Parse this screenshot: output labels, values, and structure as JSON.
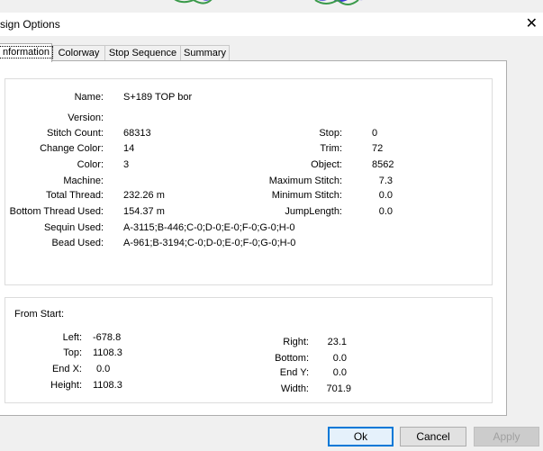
{
  "window": {
    "title": "sign Options",
    "close_glyph": "✕"
  },
  "tabs": [
    {
      "label": "nformation",
      "active": true
    },
    {
      "label": "Colorway",
      "active": false
    },
    {
      "label": "Stop Sequence",
      "active": false
    },
    {
      "label": "Summary",
      "active": false
    }
  ],
  "info": {
    "name_label": "Name:",
    "name_value": "S+189 TOP bor",
    "version_label": "Version:",
    "version_value": "",
    "stitch_count_label": "Stitch Count:",
    "stitch_count_value": "68313",
    "change_color_label": "Change Color:",
    "change_color_value": "14",
    "color_label": "Color:",
    "color_value": "3",
    "machine_label": "Machine:",
    "machine_value": "",
    "total_thread_label": "Total Thread:",
    "total_thread_value": "232.26 m",
    "bottom_thread_label": "Bottom Thread Used:",
    "bottom_thread_value": "154.37 m",
    "sequin_label": "Sequin Used:",
    "sequin_value": "A-3115;B-446;C-0;D-0;E-0;F-0;G-0;H-0",
    "bead_label": "Bead Used:",
    "bead_value": "A-961;B-3194;C-0;D-0;E-0;F-0;G-0;H-0",
    "stop_label": "Stop:",
    "stop_value": "0",
    "trim_label": "Trim:",
    "trim_value": "72",
    "object_label": "Object:",
    "object_value": "8562",
    "max_stitch_label": "Maximum Stitch:",
    "max_stitch_value": "7.3",
    "min_stitch_label": "Minimum Stitch:",
    "min_stitch_value": "0.0",
    "jump_length_label": "JumpLength:",
    "jump_length_value": "0.0"
  },
  "from_start": {
    "heading": "From Start:",
    "left_label": "Left:",
    "left_value": "-678.8",
    "top_label": "Top:",
    "top_value": "1108.3",
    "endx_label": "End X:",
    "endx_value": "0.0",
    "height_label": "Height:",
    "height_value": "1108.3",
    "right_label": "Right:",
    "right_value": "23.1",
    "bottom_label": "Bottom:",
    "bottom_value": "0.0",
    "endy_label": "End Y:",
    "endy_value": "0.0",
    "width_label": "Width:",
    "width_value": "701.9"
  },
  "buttons": {
    "ok": "Ok",
    "cancel": "Cancel",
    "apply": "Apply"
  },
  "colors": {
    "accent": "#0078d7",
    "deco_blue": "#3a3ad8",
    "deco_green": "#3a9a4a"
  }
}
